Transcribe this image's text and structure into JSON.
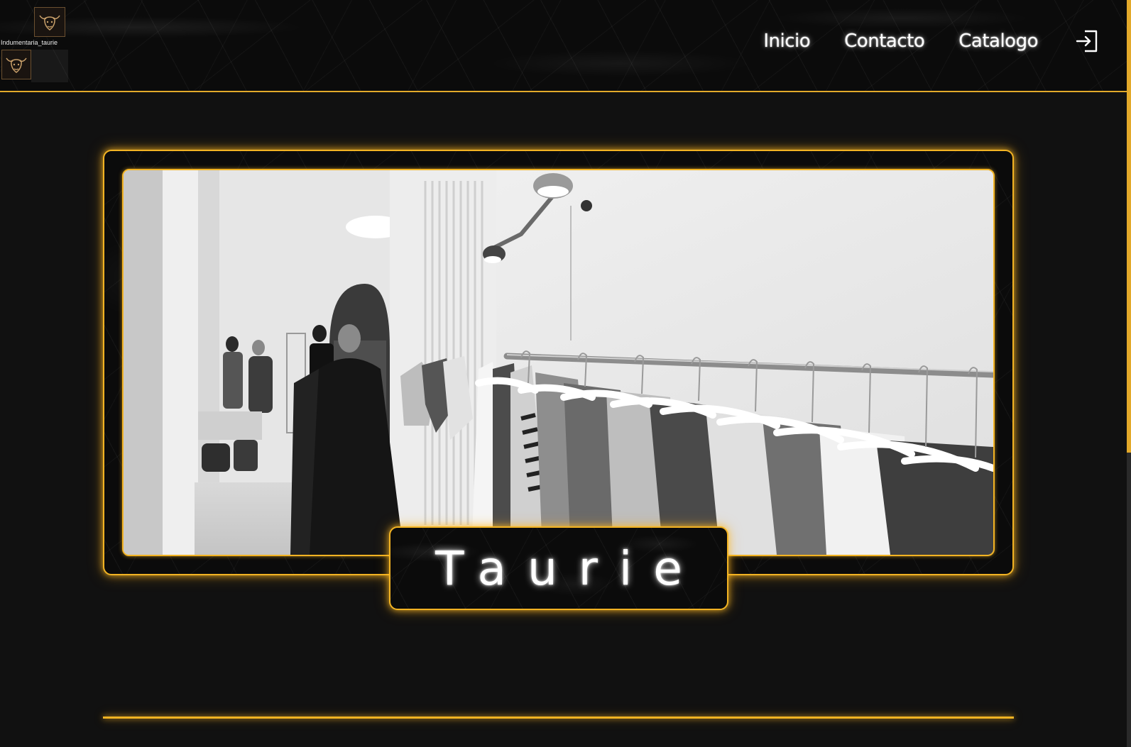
{
  "header": {
    "logo_alt": "Indumentaria_taurie",
    "nav": [
      {
        "label": "Inicio"
      },
      {
        "label": "Contacto"
      },
      {
        "label": "Catalogo"
      }
    ],
    "login_icon": "login-icon"
  },
  "hero": {
    "image_subject": "clothing-store-rack-photo",
    "title": "Taurie"
  },
  "colors": {
    "accent": "#f2b323",
    "background": "#111111",
    "header_bg": "#0b0b0b",
    "text": "#ffffff"
  }
}
